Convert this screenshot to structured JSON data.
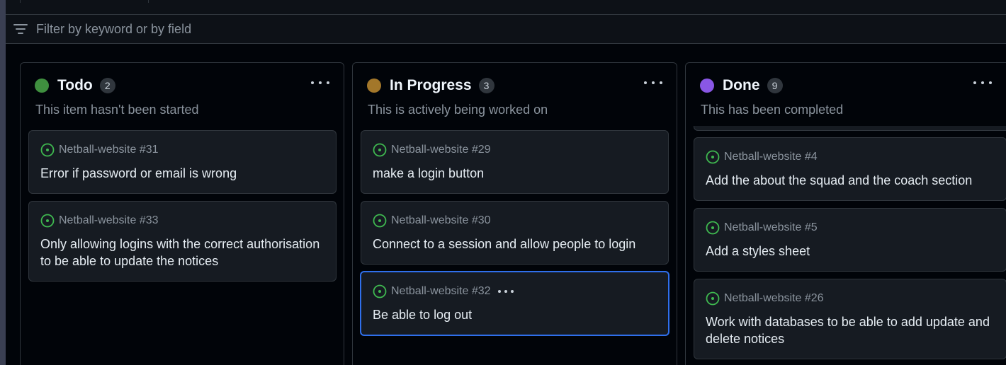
{
  "filter": {
    "placeholder": "Filter by keyword or by field"
  },
  "colors": {
    "todo": "#3f8f3f",
    "in_progress": "#a3772a",
    "done": "#8957e5",
    "issue_open": "#3fb950",
    "selected_border": "#2f6feb"
  },
  "columns": [
    {
      "title": "Todo",
      "count": "2",
      "description": "This item hasn't been started",
      "cards": [
        {
          "ref": "Netball-website #31",
          "title": "Error if password or email is wrong"
        },
        {
          "ref": "Netball-website #33",
          "title": "Only allowing logins with the correct authorisation to be able to update the notices"
        }
      ]
    },
    {
      "title": "In Progress",
      "count": "3",
      "description": "This is actively being worked on",
      "cards": [
        {
          "ref": "Netball-website #29",
          "title": "make a login button"
        },
        {
          "ref": "Netball-website #30",
          "title": "Connect to a session and allow people to login"
        },
        {
          "ref": "Netball-website #32",
          "title": "Be able to log out"
        }
      ]
    },
    {
      "title": "Done",
      "count": "9",
      "description": "This has been completed",
      "cards": [
        {
          "ref": "Netball-website #4",
          "title": "Add the about the squad and the coach section"
        },
        {
          "ref": "Netball-website #5",
          "title": "Add a styles sheet"
        },
        {
          "ref": "Netball-website #26",
          "title": "Work with databases to be able to add update and delete notices"
        }
      ]
    }
  ]
}
